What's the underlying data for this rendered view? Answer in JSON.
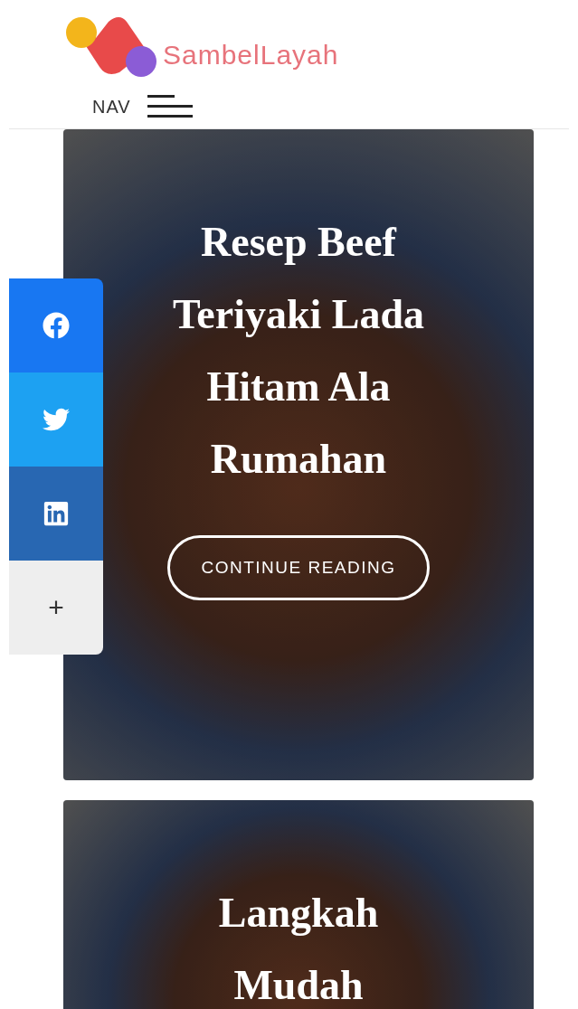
{
  "header": {
    "logo_text": "SambelLayah",
    "nav_label": "NAV"
  },
  "share_bar": [
    {
      "kind": "facebook",
      "color": "#1877f2"
    },
    {
      "kind": "twitter",
      "color": "#1da1f2"
    },
    {
      "kind": "linkedin",
      "color": "#2867b2"
    },
    {
      "kind": "more",
      "label": "+",
      "color": "#eeeeee"
    }
  ],
  "posts": [
    {
      "title": "Resep Beef Teriyaki Lada Hitam Ala Rumahan",
      "button": "CONTINUE READING"
    },
    {
      "title": "Langkah Mudah"
    }
  ]
}
